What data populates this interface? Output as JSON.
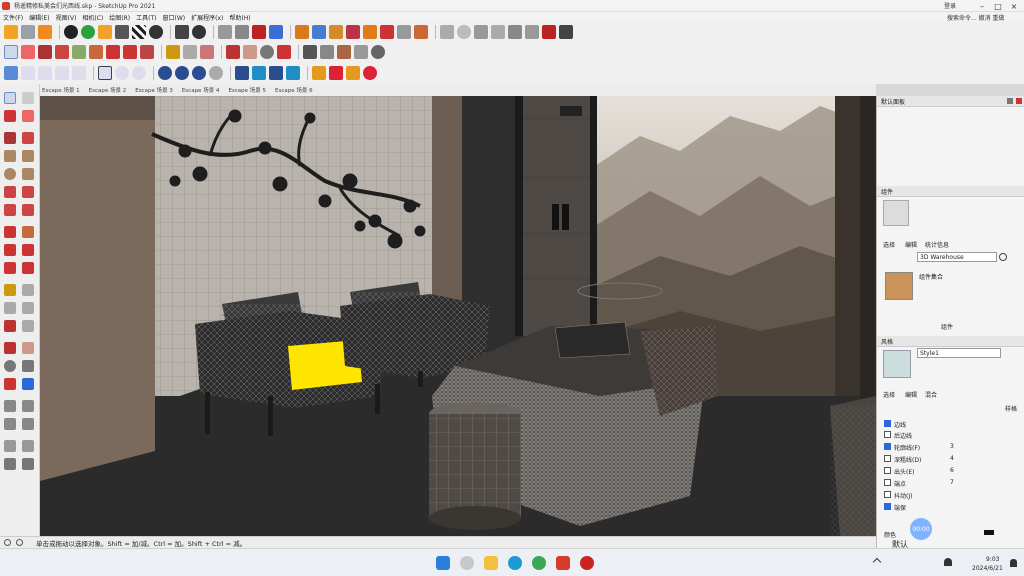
{
  "window": {
    "title": "杨遥精修私美会们光西线.skp - SketchUp Pro 2021",
    "login": "登录"
  },
  "menu": {
    "items": [
      "文件(F)",
      "编辑(E)",
      "视图(V)",
      "相机(C)",
      "绘图(R)",
      "工具(T)",
      "窗口(W)",
      "扩展程序(x)",
      "帮助(H)"
    ],
    "right_text": "搜索命令...   撤消    重做"
  },
  "scenes": [
    "Escape 场景 1",
    "Escape 场景 2",
    "Escape 场景 3",
    "Escape 场景 4",
    "Escape 场景 5",
    "Escape 场景 6"
  ],
  "tray": {
    "title": "默认面板",
    "components_title": "组件",
    "comp_tabs": [
      "选择",
      "编辑",
      "统计信息"
    ],
    "warehouse": "3D Warehouse",
    "comp_item": "组件集合",
    "rail_label": "组件",
    "styles_title": "风格",
    "style_name": "Style1",
    "style_tabs": [
      "选择",
      "编辑",
      "混合"
    ],
    "right_label": "样格",
    "options": [
      {
        "label": "边线",
        "checked": true
      },
      {
        "label": "后边线",
        "checked": false
      },
      {
        "label": "轮廓线(F)",
        "checked": true,
        "value": "3"
      },
      {
        "label": "深粗线(D)",
        "checked": false,
        "value": "4"
      },
      {
        "label": "出头(E)",
        "checked": false,
        "value": "6"
      },
      {
        "label": "端点",
        "checked": false,
        "value": "7"
      },
      {
        "label": "抖动(J)",
        "checked": false
      },
      {
        "label": "端保",
        "checked": true
      }
    ],
    "bottom_label": "颜色",
    "bottom_label2": "默认"
  },
  "status": {
    "hint": "单击或拖动以选择对象。Shift = 加/减。Ctrl = 加。Shift + Ctrl = 减。"
  },
  "record_button": "00:00",
  "taskbar": {
    "time": "9:03",
    "date": "2024/6/21"
  },
  "colors": {
    "highlight": "#ffe600",
    "accent": "#2a6ad8"
  }
}
